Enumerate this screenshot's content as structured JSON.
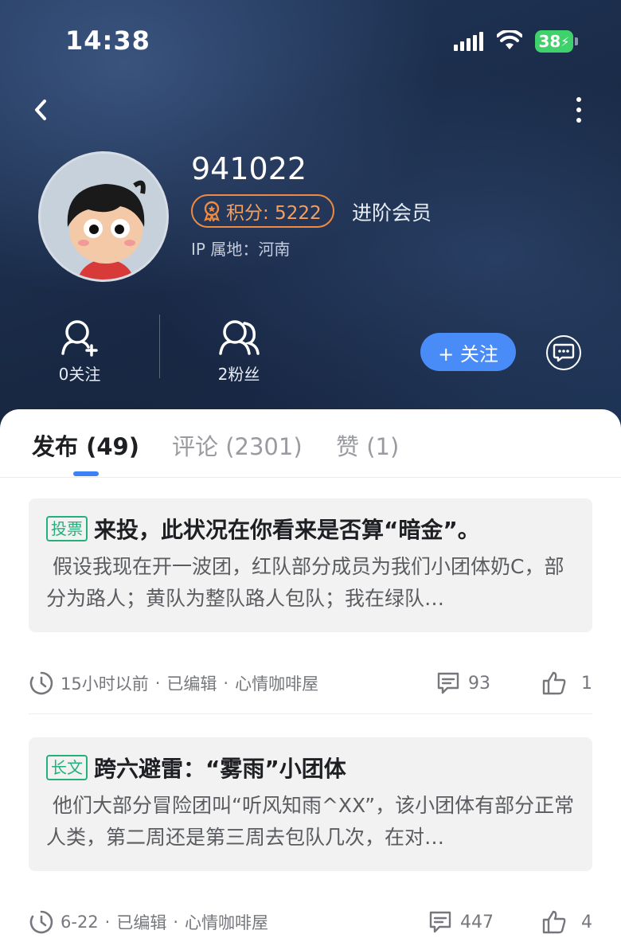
{
  "status_bar": {
    "time": "14:38",
    "battery": "38"
  },
  "profile": {
    "username": "941022",
    "points_label": "积分: 5222",
    "member_level": "进阶会员",
    "ip_location": "IP 属地：河南",
    "following_label": "0关注",
    "followers_label": "2粉丝",
    "follow_button": "+ 关注"
  },
  "tabs": [
    {
      "label": "发布 (49)",
      "active": true
    },
    {
      "label": "评论 (2301)",
      "active": false
    },
    {
      "label": "赞 (1)",
      "active": false
    }
  ],
  "posts": [
    {
      "tag": "投票",
      "title": "来投，此状况在你看来是否算“暗金”。",
      "excerpt": "假设我现在开一波团，红队部分成员为我们小团体奶C，部分为路人；黄队为整队路人包队；我在绿队…",
      "time": "15小时以前",
      "edited": "已编辑",
      "board": "心情咖啡屋",
      "comments": "93",
      "likes": "1"
    },
    {
      "tag": "长文",
      "title": "跨六避雷：“雾雨”小团体",
      "excerpt": "他们大部分冒险团叫“听风知雨^XX”，该小团体有部分正常人类，第二周还是第三周去包队几次，在对…",
      "time": "6-22",
      "edited": "已编辑",
      "board": "心情咖啡屋",
      "comments": "447",
      "likes": "4"
    }
  ],
  "colors": {
    "accent": "#4a8cf7",
    "badge": "#f08a40",
    "tag": "#23b07a"
  }
}
